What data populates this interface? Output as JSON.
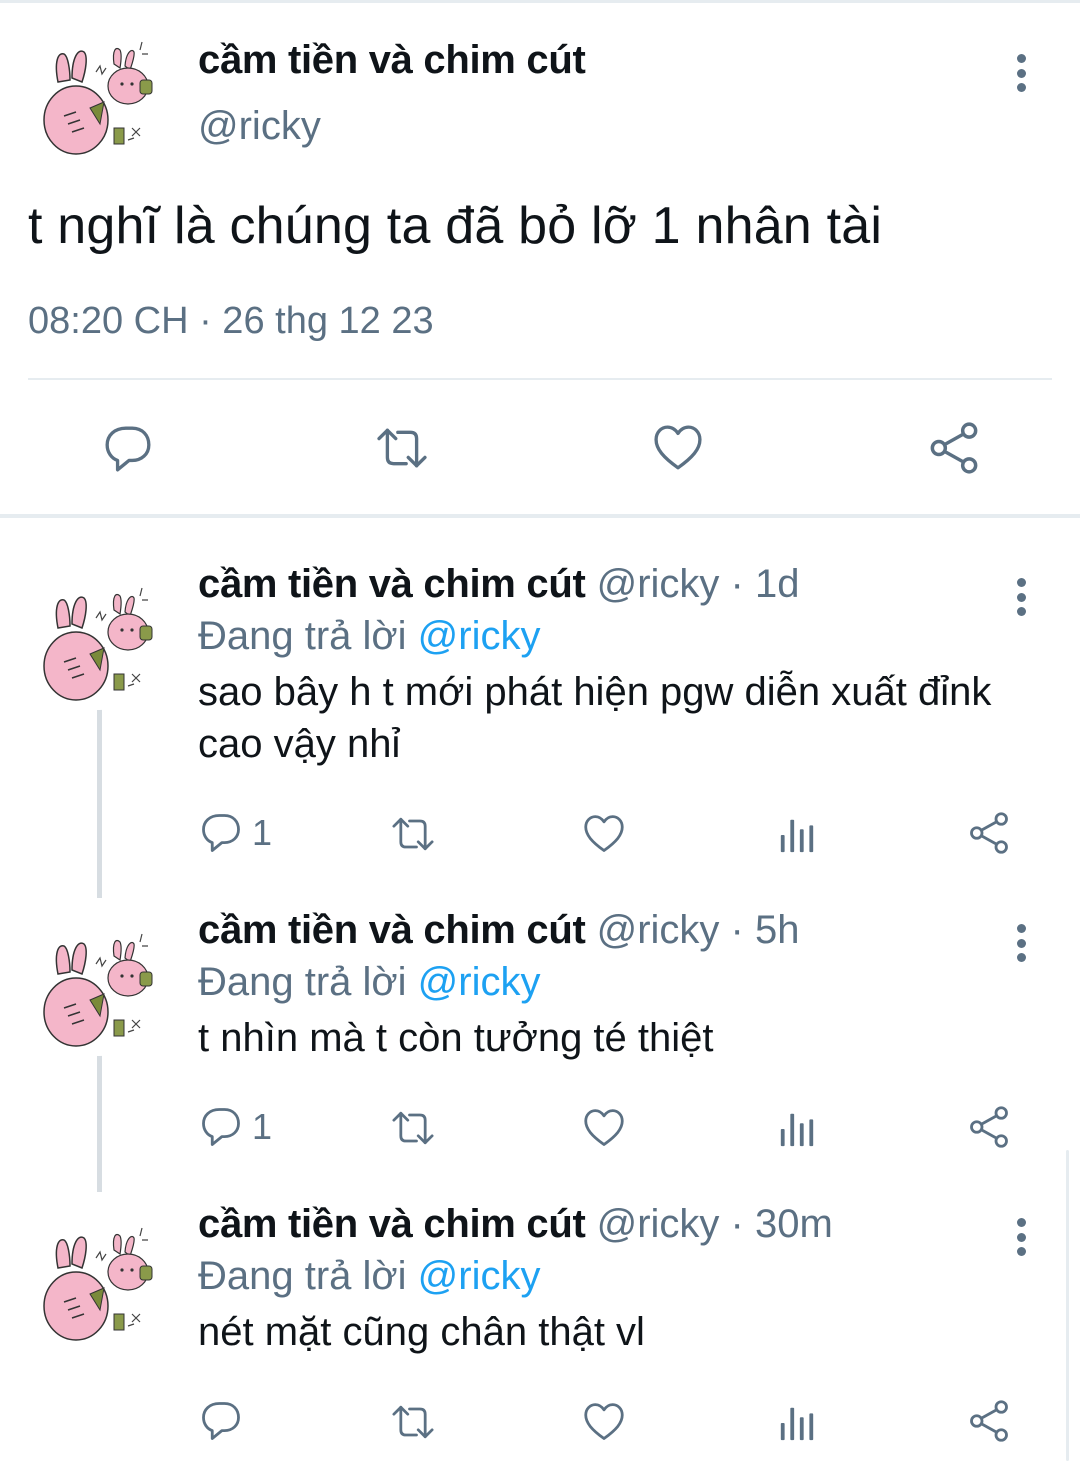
{
  "colors": {
    "text": "#0f1419",
    "secondary": "#5b7083",
    "link": "#1da1f2",
    "divider": "#e6ecf0",
    "avatar_pink": "#f4b6c9"
  },
  "main_tweet": {
    "display_name": "cầm tiền và chim cút",
    "handle": "@ricky",
    "text": "t nghĩ là chúng ta đã bỏ lỡ 1 nhân tài",
    "timestamp": "08:20 CH · 26 thg 12 23",
    "icons": [
      "reply-icon",
      "retweet-icon",
      "like-icon",
      "share-icon"
    ]
  },
  "replies": [
    {
      "display_name": "cầm tiền và chim cút",
      "meta": "@ricky · 1d",
      "replying_prefix": "Đang trả lời ",
      "replying_to": "@ricky",
      "text": "sao bây h t mới phát hiện pgw diễn xuất đỉnk cao vậy nhỉ",
      "reply_count": "1"
    },
    {
      "display_name": "cầm tiền và chim cút",
      "meta": "@ricky · 5h",
      "replying_prefix": "Đang trả lời ",
      "replying_to": "@ricky",
      "text": "t nhìn mà t còn tưởng té thiệt",
      "reply_count": "1"
    },
    {
      "display_name": "cầm tiền và chim cút",
      "meta": "@ricky · 30m",
      "replying_prefix": "Đang trả lời ",
      "replying_to": "@ricky",
      "text": "nét mặt cũng chân thật vl",
      "reply_count": ""
    }
  ]
}
